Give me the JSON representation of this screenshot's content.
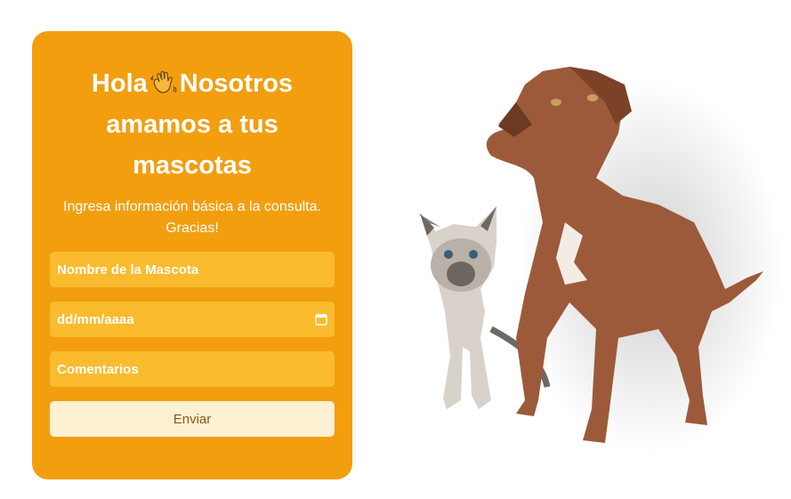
{
  "form": {
    "title_part1": "Hola",
    "wave_icon": "waving-hand-icon",
    "title_part2": "Nosotros amamos a tus mascotas",
    "subtitle": "Ingresa información básica a la consulta. Gracias!",
    "pet_name_placeholder": "Nombre de la Mascota",
    "date_placeholder": "dd/mm/aaaa",
    "calendar_icon": "calendar-icon",
    "comments_placeholder": "Comentarios",
    "submit_label": "Enviar"
  },
  "colors": {
    "card": "#f29e0f",
    "field": "#fbbb2e",
    "button": "#fdf0d3"
  },
  "image": {
    "subject": "dog-and-cat-photo"
  }
}
